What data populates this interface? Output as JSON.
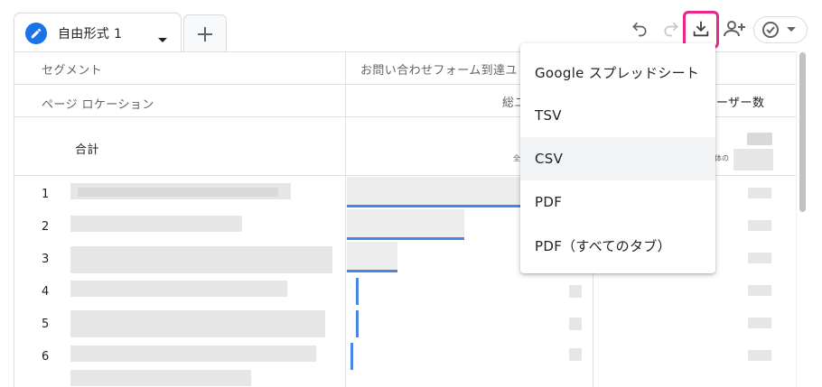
{
  "tabs": {
    "active_label": "自由形式 1",
    "add_symbol": "+"
  },
  "toolbar": {
    "icons": [
      "undo-icon",
      "redo-icon",
      "download-icon",
      "share-user-icon",
      "status-check-icon"
    ],
    "highlight_color": "#e8298a"
  },
  "table": {
    "header_segment": "セグメント",
    "header_segment_value": "お問い合わせフォーム到達ユ",
    "header_dimension": "ページ ロケーション",
    "header_metric_partial": "総ユ",
    "header_metric_right": "ーザー数",
    "total_label": "合計",
    "total_sub_left": "全",
    "total_sub_right": "体の",
    "rows": [
      {
        "num": "1"
      },
      {
        "num": "2"
      },
      {
        "num": "3"
      },
      {
        "num": "4"
      },
      {
        "num": "5"
      },
      {
        "num": "6"
      }
    ]
  },
  "menu": {
    "items": [
      {
        "label": "Google スプレッドシート"
      },
      {
        "label": "TSV"
      },
      {
        "label": "CSV"
      },
      {
        "label": "PDF"
      },
      {
        "label": "PDF（すべてのタブ）"
      }
    ]
  },
  "colors": {
    "accent": "#1a73e8",
    "bar": "#4a86e8"
  }
}
